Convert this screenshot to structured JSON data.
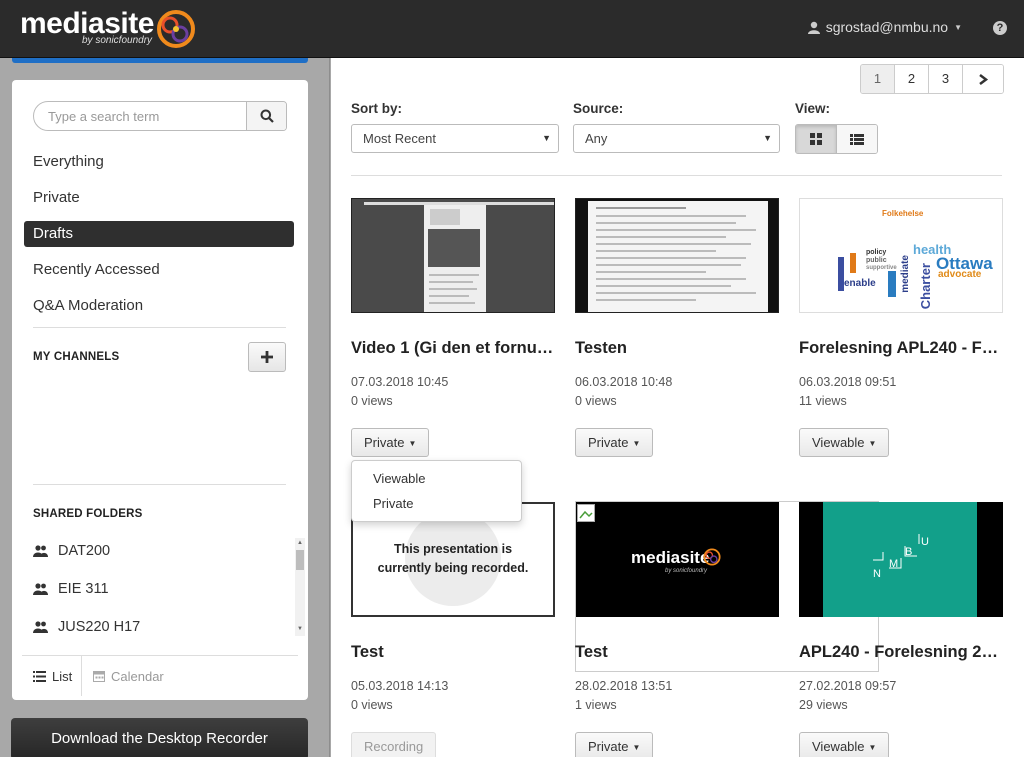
{
  "header": {
    "logo_word": "mediasite",
    "logo_sub": "by sonicfoundry",
    "user": "sgrostad@nmbu.no",
    "help": "?"
  },
  "sidebar": {
    "search_placeholder": "Type a search term",
    "nav": [
      {
        "label": "Everything"
      },
      {
        "label": "Private"
      },
      {
        "label": "Drafts",
        "active": true
      },
      {
        "label": "Recently Accessed"
      },
      {
        "label": "Q&A Moderation"
      }
    ],
    "my_channels_title": "MY CHANNELS",
    "shared_folders_title": "SHARED FOLDERS",
    "shared_folders": [
      "DAT200",
      "EIE 311",
      "JUS220 H17"
    ],
    "view_list": "List",
    "view_calendar": "Calendar",
    "download_label": "Download the Desktop Recorder"
  },
  "pager": {
    "pages": [
      "1",
      "2",
      "3"
    ],
    "current": "1"
  },
  "controls": {
    "sort_label": "Sort by:",
    "sort_value": "Most Recent",
    "source_label": "Source:",
    "source_value": "Any",
    "view_label": "View:"
  },
  "cards": [
    {
      "title": "Video 1 (Gi den et fornuf…",
      "date": "07.03.2018 10:45",
      "views": "0 views",
      "status": "Private",
      "has_menu": true
    },
    {
      "title": "Testen",
      "date": "06.03.2018 10:48",
      "views": "0 views",
      "status": "Private",
      "has_menu": true
    },
    {
      "title": "Forelesning APL240 - Fo…",
      "date": "06.03.2018 09:51",
      "views": "11 views",
      "status": "Viewable",
      "has_menu": true
    },
    {
      "title": "Test",
      "date": "05.03.2018 14:13",
      "views": "0 views",
      "status": "Recording",
      "has_menu": false,
      "recording_text": "This presentation is currently being recorded."
    },
    {
      "title": "Test",
      "date": "28.02.2018 13:51",
      "views": "1 views",
      "status": "Private",
      "has_menu": true
    },
    {
      "title": "APL240 - Forelesning 27…",
      "date": "27.02.2018 09:57",
      "views": "29 views",
      "status": "Viewable",
      "has_menu": true
    }
  ],
  "dropdown": {
    "items": [
      "Viewable",
      "Private"
    ]
  },
  "thumb_text": {
    "folkehelse_title": "Folkehelse",
    "wordcloud_words": [
      "health",
      "Ottawa",
      "Charter",
      "advocate",
      "enable",
      "policy",
      "public",
      "supportive",
      "mediate"
    ],
    "nmbu_letters": [
      "N",
      "M",
      "B",
      "U"
    ],
    "mediasite_logo": "mediasite",
    "mediasite_sub": "by sonicfoundry"
  },
  "colors": {
    "accent_blue": "#1f6fc6",
    "topbar": "#2b2b2b",
    "nmbu_green": "#12a08a"
  }
}
